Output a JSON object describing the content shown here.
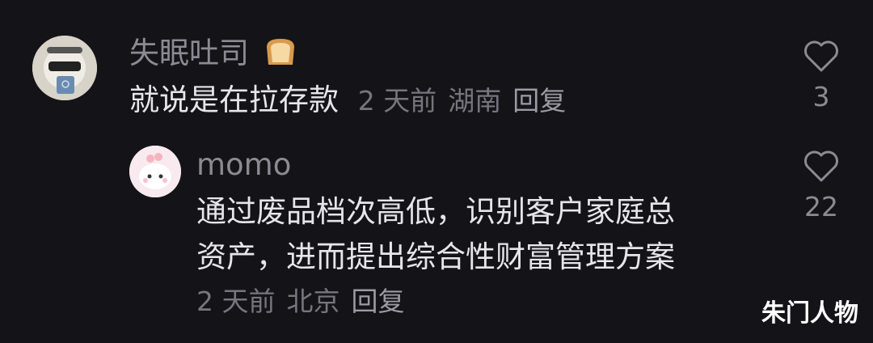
{
  "comments": [
    {
      "username": "失眠吐司",
      "text": "就说是在拉存款",
      "time": "2 天前",
      "location": "湖南",
      "reply_label": "回复",
      "likes": "3"
    },
    {
      "username": "momo",
      "text_line1": "通过废品档次高低，识别客户家庭总",
      "text_line2": "资产，进而提出综合性财富管理方案",
      "time": "2 天前",
      "location": "北京",
      "reply_label": "回复",
      "likes": "22"
    }
  ],
  "watermark": "朱门人物",
  "colors": {
    "background": "#141317",
    "text": "#e6e5ea",
    "secondary": "#8c8a93"
  }
}
